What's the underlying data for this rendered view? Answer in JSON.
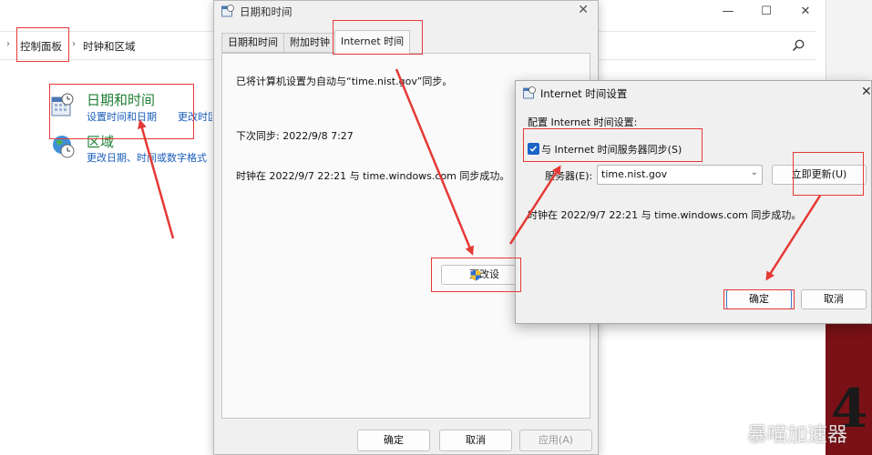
{
  "control_panel": {
    "breadcrumb": [
      "控制面板",
      "时钟和区域"
    ],
    "categories": [
      {
        "title": "日期和时间",
        "links": [
          "设置时间和日期",
          "更改时区"
        ]
      },
      {
        "title": "区域",
        "links": [
          "更改日期、时间或数字格式"
        ]
      }
    ]
  },
  "date_time_dialog": {
    "title": "日期和时间",
    "tabs": [
      "日期和时间",
      "附加时钟",
      "Internet 时间"
    ],
    "active_tab": "Internet 时间",
    "sync_text": "已将计算机设置为自动与“time.nist.gov”同步。",
    "next_sync": "下次同步: 2022/9/8 7:27",
    "last_sync": "时钟在 2022/9/7 22:21 与 time.windows.com 同步成功。",
    "change_settings_label": "更改设",
    "buttons": {
      "ok": "确定",
      "cancel": "取消",
      "apply": "应用(A)"
    }
  },
  "internet_time_dialog": {
    "title": "Internet 时间设置",
    "config_label": "配置 Internet 时间设置:",
    "sync_checkbox_label": "与 Internet 时间服务器同步(S)",
    "sync_checked": true,
    "server_label": "服务器(E):",
    "server_value": "time.nist.gov",
    "update_now_label": "立即更新(U)",
    "status": "时钟在 2022/9/7 22:21 与 time.windows.com 同步成功。",
    "buttons": {
      "ok": "确定",
      "cancel": "取消"
    }
  },
  "watermark": "暴喵加速器",
  "colors": {
    "annotation": "#e53935",
    "link": "#1a5dbb",
    "category_title": "#1e7e34",
    "accent": "#1b63c6"
  }
}
